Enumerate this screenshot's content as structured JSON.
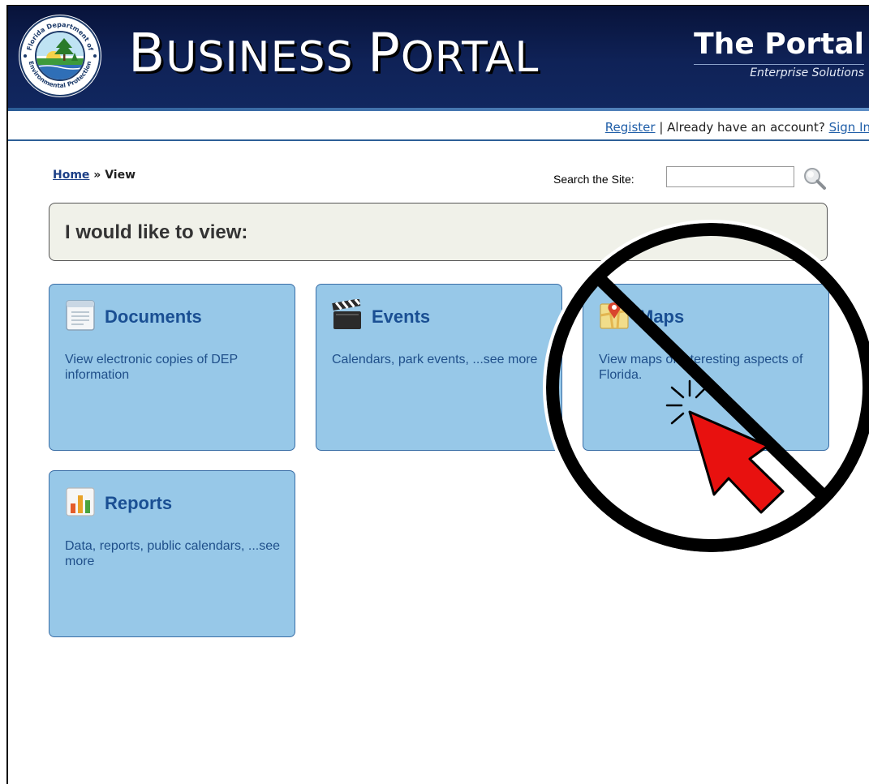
{
  "header": {
    "title_first_initial": "B",
    "title_first_rest": "USINESS",
    "title_second_initial": "P",
    "title_second_rest": "ORTAL",
    "brand_name": "The Portal",
    "brand_tagline": "Enterprise Solutions",
    "seal_top_text": "Florida Department of",
    "seal_bottom_text": "Environmental Protection"
  },
  "account_bar": {
    "register_label": "Register",
    "separator": "|",
    "prompt": "Already have an account?",
    "sign_in_label": "Sign In"
  },
  "breadcrumb": {
    "home_label": "Home",
    "separator": "»",
    "current": "View"
  },
  "search": {
    "label": "Search the Site:",
    "value": "",
    "placeholder": ""
  },
  "heading": "I would like to view:",
  "tiles": [
    {
      "title": "Documents",
      "description": "View electronic copies of DEP information",
      "icon": "document-icon"
    },
    {
      "title": "Events",
      "description": "Calendars, park events, ...see more",
      "icon": "clapperboard-icon"
    },
    {
      "title": "Maps",
      "description": "View maps of interesting aspects of Florida.",
      "icon": "map-pin-icon"
    },
    {
      "title": "Reports",
      "description": "Data, reports, public calendars, ...see more",
      "icon": "bar-chart-icon"
    }
  ],
  "overlay": {
    "icon": "prohibited-click-icon",
    "color_ring": "#000000",
    "color_cursor": "#e8110f"
  },
  "colors": {
    "banner": "#0f2257",
    "tile_bg": "#97c8e8",
    "tile_title": "#1a4f93",
    "link": "#1f5ea8"
  }
}
